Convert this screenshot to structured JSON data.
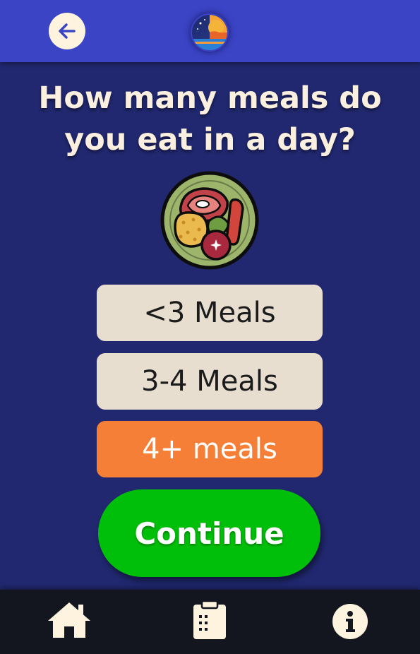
{
  "header": {
    "back_icon": "arrow-left-icon",
    "logo_icon": "sun-moon-logo-icon"
  },
  "question": {
    "line1": "How many meals do",
    "line2": "you eat in a day?",
    "illustration": "food-plate-icon"
  },
  "options": [
    {
      "label": "<3 Meals",
      "selected": false
    },
    {
      "label": "3-4 Meals",
      "selected": false
    },
    {
      "label": "4+ meals",
      "selected": true
    }
  ],
  "continue_label": "Continue",
  "bottom_nav": [
    {
      "icon": "home-icon"
    },
    {
      "icon": "clipboard-icon"
    },
    {
      "icon": "info-icon"
    }
  ],
  "colors": {
    "header": "#3b44c5",
    "background": "#21286f",
    "option_default": "#e8ded0",
    "option_selected": "#f57f36",
    "continue": "#00bf0a",
    "bottom_bar": "#13151f",
    "text_light": "#fbefdf"
  }
}
